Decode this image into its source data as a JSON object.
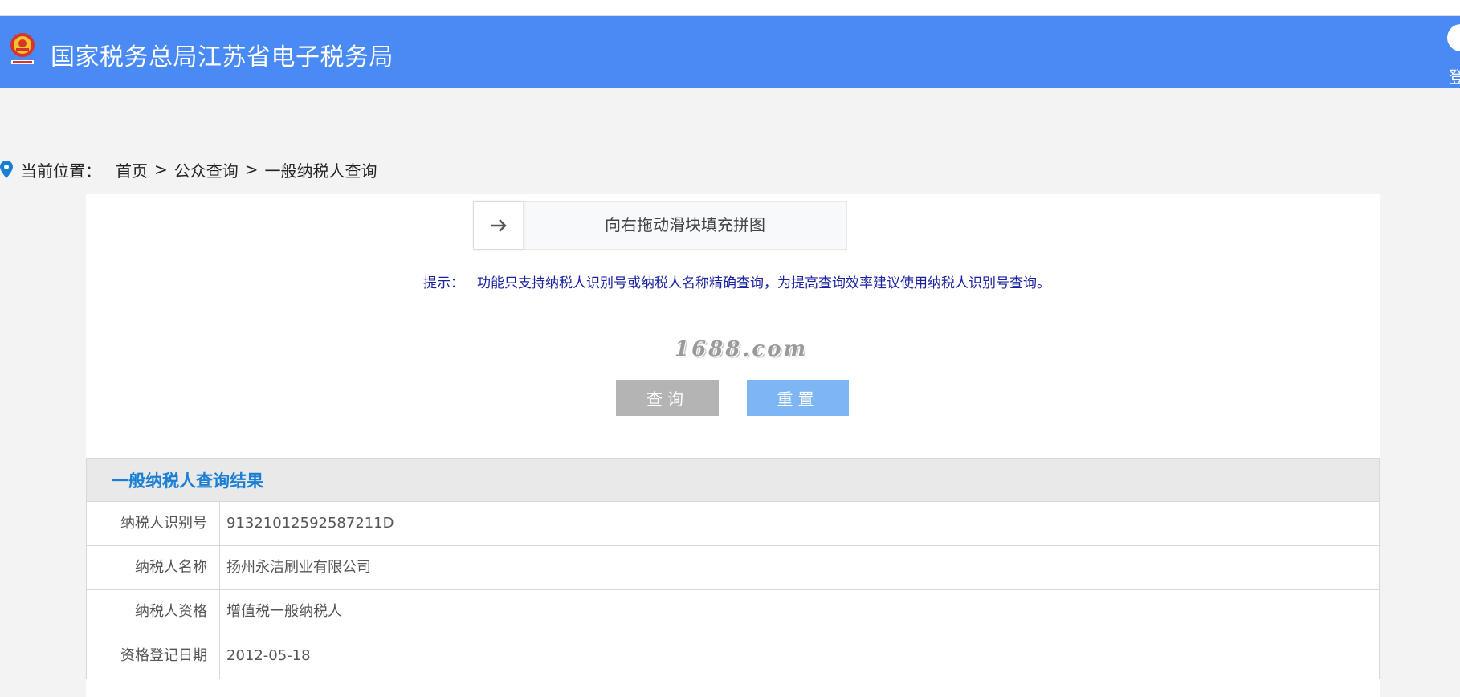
{
  "header": {
    "site_title": "国家税务总局江苏省电子税务局",
    "login_label": "登"
  },
  "breadcrumb": {
    "label": "当前位置：",
    "items": [
      "首页",
      "公众查询",
      "一般纳税人查询"
    ],
    "separator": ">"
  },
  "captcha": {
    "instruction": "向右拖动滑块填充拼图"
  },
  "hint": {
    "label": "提示：",
    "text": "功能只支持纳税人识别号或纳税人名称精确查询，为提高查询效率建议使用纳税人识别号查询。"
  },
  "watermark": "1688.com",
  "buttons": {
    "query": "查询",
    "reset": "重置"
  },
  "results": {
    "title": "一般纳税人查询结果",
    "rows": [
      {
        "key": "纳税人识别号",
        "value": "91321012592587211D"
      },
      {
        "key": "纳税人名称",
        "value": "扬州永洁刷业有限公司"
      },
      {
        "key": "纳税人资格",
        "value": "增值税一般纳税人"
      },
      {
        "key": "资格登记日期",
        "value": "2012-05-18"
      }
    ]
  },
  "colors": {
    "topbar": "#4a8af4",
    "hint": "#1a22a0",
    "results_title": "#1a7fd4",
    "query_button": "#b4b4b4",
    "reset_button": "#7eb6f3"
  }
}
